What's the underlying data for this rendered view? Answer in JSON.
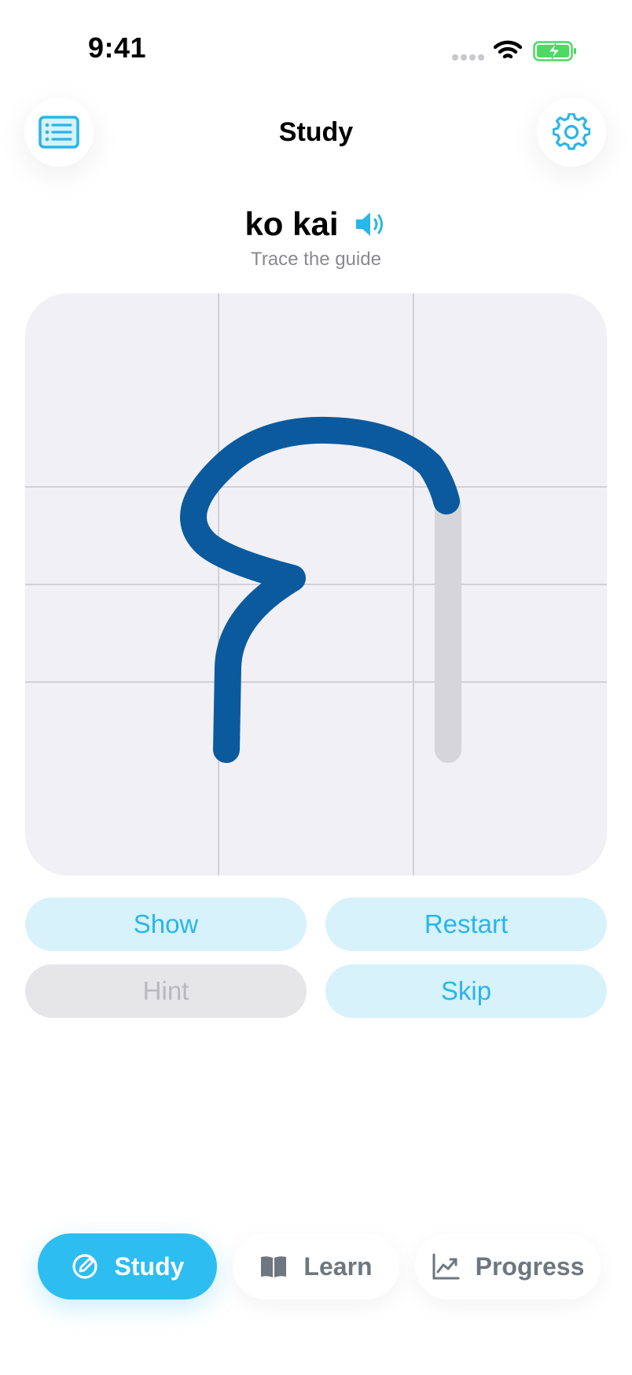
{
  "status_bar": {
    "time": "9:41"
  },
  "header": {
    "title": "Study",
    "left_icon": "list-icon",
    "right_icon": "gear-icon"
  },
  "word": {
    "title": "ko kai",
    "instruction": "Trace the guide",
    "audio_icon": "speaker-icon"
  },
  "actions": {
    "show": "Show",
    "restart": "Restart",
    "hint": "Hint",
    "skip": "Skip"
  },
  "tabs": [
    {
      "label": "Study",
      "icon": "pencil-circle-icon",
      "active": true
    },
    {
      "label": "Learn",
      "icon": "book-icon",
      "active": false
    },
    {
      "label": "Progress",
      "icon": "chart-icon",
      "active": false
    }
  ],
  "colors": {
    "accent": "#2dbdf0",
    "stroke_done": "#0b5a9e",
    "stroke_guide": "#d6d6da",
    "canvas_bg": "#f1f0f5",
    "grid": "#d0d0d6"
  }
}
